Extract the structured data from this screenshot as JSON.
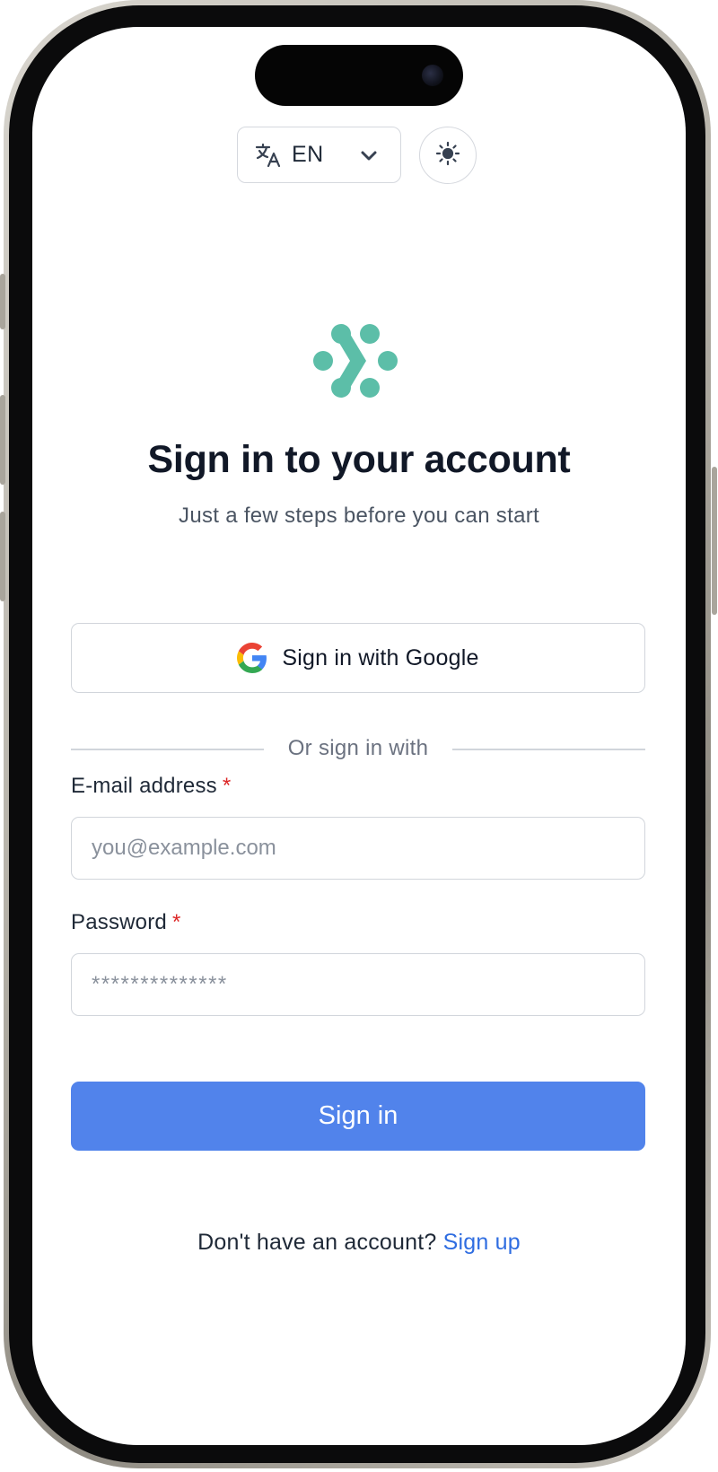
{
  "language_selector": {
    "value": "EN",
    "icon": "translate-icon",
    "chevron_icon": "chevron-down-icon"
  },
  "theme_toggle": {
    "icon": "sun-icon"
  },
  "brand": {
    "logo_icon": "brand-logo",
    "color": "#5cbea8"
  },
  "header": {
    "title": "Sign in to your account",
    "subtitle": "Just a few steps before you can start"
  },
  "google_sign_in": {
    "label": "Sign in with Google",
    "icon": "google-icon"
  },
  "divider": {
    "text": "Or sign in with"
  },
  "form": {
    "email": {
      "label": "E-mail address",
      "required_mark": "*",
      "placeholder": "you@example.com",
      "value": ""
    },
    "password": {
      "label": "Password",
      "required_mark": "*",
      "placeholder": "**************",
      "value": ""
    },
    "submit_label": "Sign in"
  },
  "footer": {
    "prompt": "Don't have an account?",
    "link_label": "Sign up"
  },
  "colors": {
    "primary": "#5183eb",
    "link": "#2f6de1",
    "required": "#dc2626",
    "heading": "#111827"
  }
}
